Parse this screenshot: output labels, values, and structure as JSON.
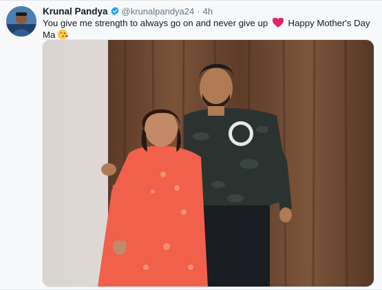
{
  "tweet": {
    "author": {
      "display_name": "Krunal Pandya",
      "handle": "@krunalpandya24",
      "verified": true
    },
    "separator": "·",
    "time": "4h",
    "text_main": "You give me strength to always go on and never give up",
    "text_tail": "Happy Mother's Day Ma",
    "emojis": [
      "heart-icon",
      "kiss-icon"
    ],
    "media": {
      "type": "photo"
    }
  },
  "colors": {
    "name": "#14171a",
    "muted": "#657786",
    "verified_blue": "#1da1f2",
    "heart_red": "#e0245e",
    "background": "#f7f9fa"
  }
}
